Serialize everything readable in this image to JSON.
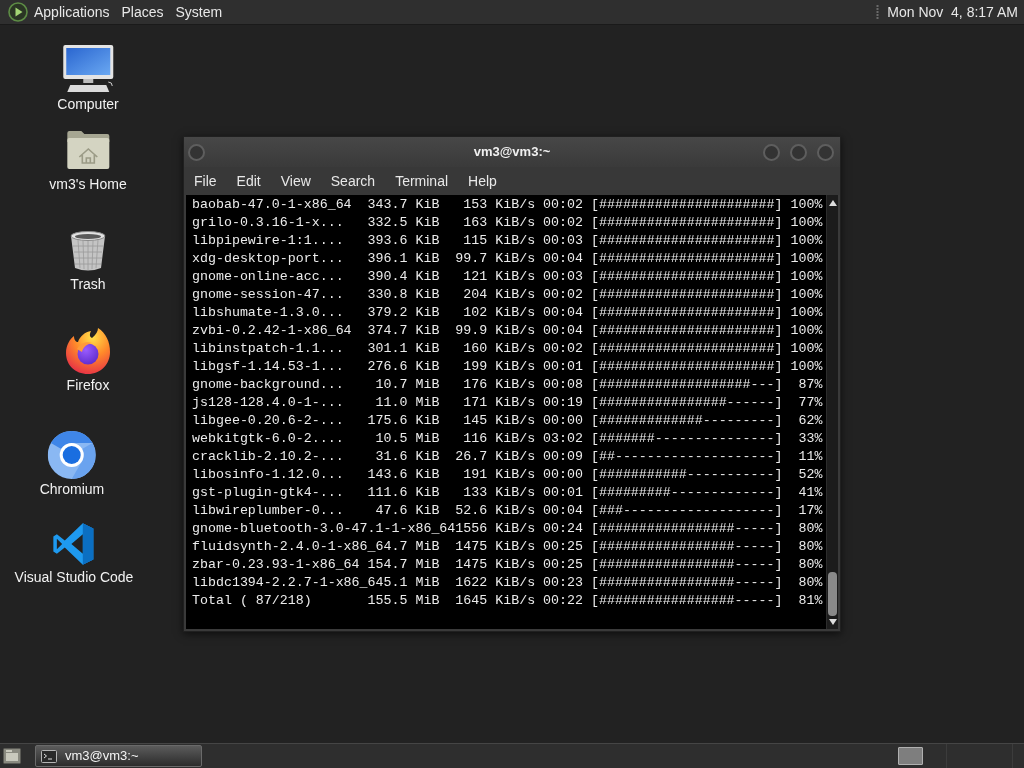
{
  "top_panel": {
    "menus": [
      "Applications",
      "Places",
      "System"
    ],
    "clock": "Mon Nov  4, 8:17 AM"
  },
  "desktop_icons": [
    {
      "label": "Computer",
      "kind": "computer"
    },
    {
      "label": "vm3's Home",
      "kind": "home"
    },
    {
      "label": "Trash",
      "kind": "trash"
    },
    {
      "label": "Firefox",
      "kind": "firefox"
    },
    {
      "label": "Chromium",
      "kind": "chromium"
    },
    {
      "label": "Visual Studio Code",
      "kind": "vscode"
    }
  ],
  "terminal_window": {
    "title": "vm3@vm3:~",
    "menu": [
      "File",
      "Edit",
      "View",
      "Search",
      "Terminal",
      "Help"
    ],
    "lines": [
      "baobab-47.0-1-x86_64  343.7 KiB   153 KiB/s 00:02 [######################] 100%",
      "grilo-0.3.16-1-x...   332.5 KiB   163 KiB/s 00:02 [######################] 100%",
      "libpipewire-1:1....   393.6 KiB   115 KiB/s 00:03 [######################] 100%",
      "xdg-desktop-port...   396.1 KiB  99.7 KiB/s 00:04 [######################] 100%",
      "gnome-online-acc...   390.4 KiB   121 KiB/s 00:03 [######################] 100%",
      "gnome-session-47...   330.8 KiB   204 KiB/s 00:02 [######################] 100%",
      "libshumate-1.3.0...   379.2 KiB   102 KiB/s 00:04 [######################] 100%",
      "zvbi-0.2.42-1-x86_64  374.7 KiB  99.9 KiB/s 00:04 [######################] 100%",
      "libinstpatch-1.1...   301.1 KiB   160 KiB/s 00:02 [######################] 100%",
      "libgsf-1.14.53-1...   276.6 KiB   199 KiB/s 00:01 [######################] 100%",
      "gnome-background...    10.7 MiB   176 KiB/s 00:08 [###################---]  87%",
      "js128-128.4.0-1-...    11.0 MiB   171 KiB/s 00:19 [################------]  77%",
      "libgee-0.20.6-2-...   175.6 KiB   145 KiB/s 00:00 [#############---------]  62%",
      "webkitgtk-6.0-2....    10.5 MiB   116 KiB/s 03:02 [#######---------------]  33%",
      "cracklib-2.10.2-...    31.6 KiB  26.7 KiB/s 00:09 [##--------------------]  11%",
      "libosinfo-1.12.0...   143.6 KiB   191 KiB/s 00:00 [###########-----------]  52%",
      "gst-plugin-gtk4-...   111.6 KiB   133 KiB/s 00:01 [#########-------------]  41%",
      "libwireplumber-0...    47.6 KiB  52.6 KiB/s 00:04 [###-------------------]  17%",
      "gnome-bluetooth-3.0-47.1-1-x86_641556 KiB/s 00:24 [#################-----]  80%",
      "fluidsynth-2.4.0-1-x86_64.7 MiB  1475 KiB/s 00:25 [#################-----]  80%",
      "zbar-0.23.93-1-x86_64 154.7 MiB  1475 KiB/s 00:25 [#################-----]  80%",
      "libdc1394-2.2.7-1-x86_645.1 MiB  1622 KiB/s 00:23 [#################-----]  80%",
      "Total ( 87/218)       155.5 MiB  1645 KiB/s 00:22 [#################-----]  81%"
    ]
  },
  "bottom_panel": {
    "window_buttons": [
      "vm3@vm3:~"
    ]
  }
}
